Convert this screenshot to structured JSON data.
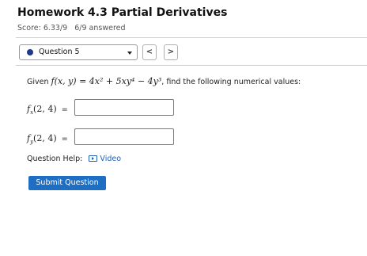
{
  "header": {
    "title": "Homework 4.3 Partial Derivatives",
    "score": "Score: 6.33/9",
    "answered": "6/9 answered"
  },
  "question_selector": {
    "label": "Question 5",
    "status_color": "#1f3a8a",
    "prev_label": "<",
    "next_label": ">"
  },
  "question": {
    "given_prefix": "Given",
    "function_text": "f(x, y) = 4x² + 5xy⁴ − 4y³",
    "given_suffix": ", find the following numerical values:",
    "parts": [
      {
        "partial": "f_x(2, 4)",
        "var": "x",
        "point": "(2, 4)",
        "equals": "=",
        "value": ""
      },
      {
        "partial": "f_y(2, 4)",
        "var": "y",
        "point": "(2, 4)",
        "equals": "=",
        "value": ""
      }
    ]
  },
  "help": {
    "label": "Question Help:",
    "video_label": "Video",
    "icon": "video-icon"
  },
  "submit": {
    "label": "Submit Question"
  },
  "colors": {
    "accent": "#1e6ec3",
    "link": "#1f5fb4"
  }
}
